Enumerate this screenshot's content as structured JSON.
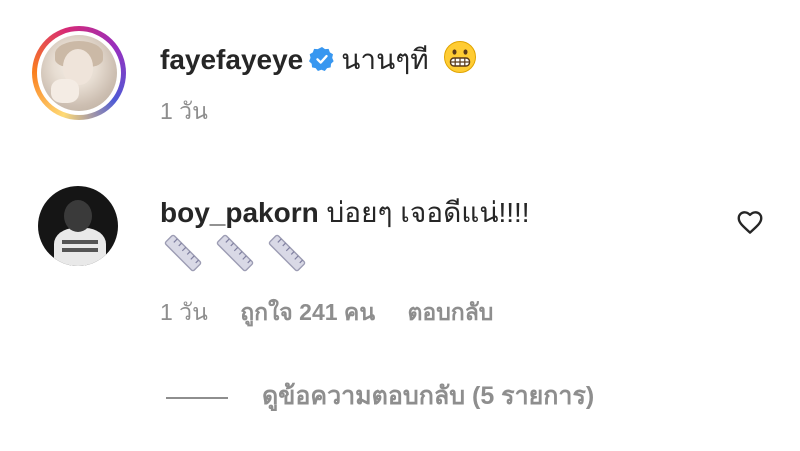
{
  "post": {
    "username": "fayefayeye",
    "caption": "นานๆที",
    "time": "1 วัน",
    "emoji_icon": "grimacing-face-emoji",
    "verified_icon": "verified-badge-icon"
  },
  "comment": {
    "username": "boy_pakorn",
    "text": "บ่อยๆ เจอดีแน่!!!!",
    "sticker_icon": "ruler-sticker",
    "sticker_count": 3,
    "time": "1 วัน",
    "likes": "ถูกใจ 241 คน",
    "reply_label": "ตอบกลับ"
  },
  "replies": {
    "label": "ดูข้อความตอบกลับ (5 รายการ)"
  },
  "colors": {
    "text": "#262626",
    "muted": "#8e8e8e",
    "verified": "#3897f0"
  }
}
